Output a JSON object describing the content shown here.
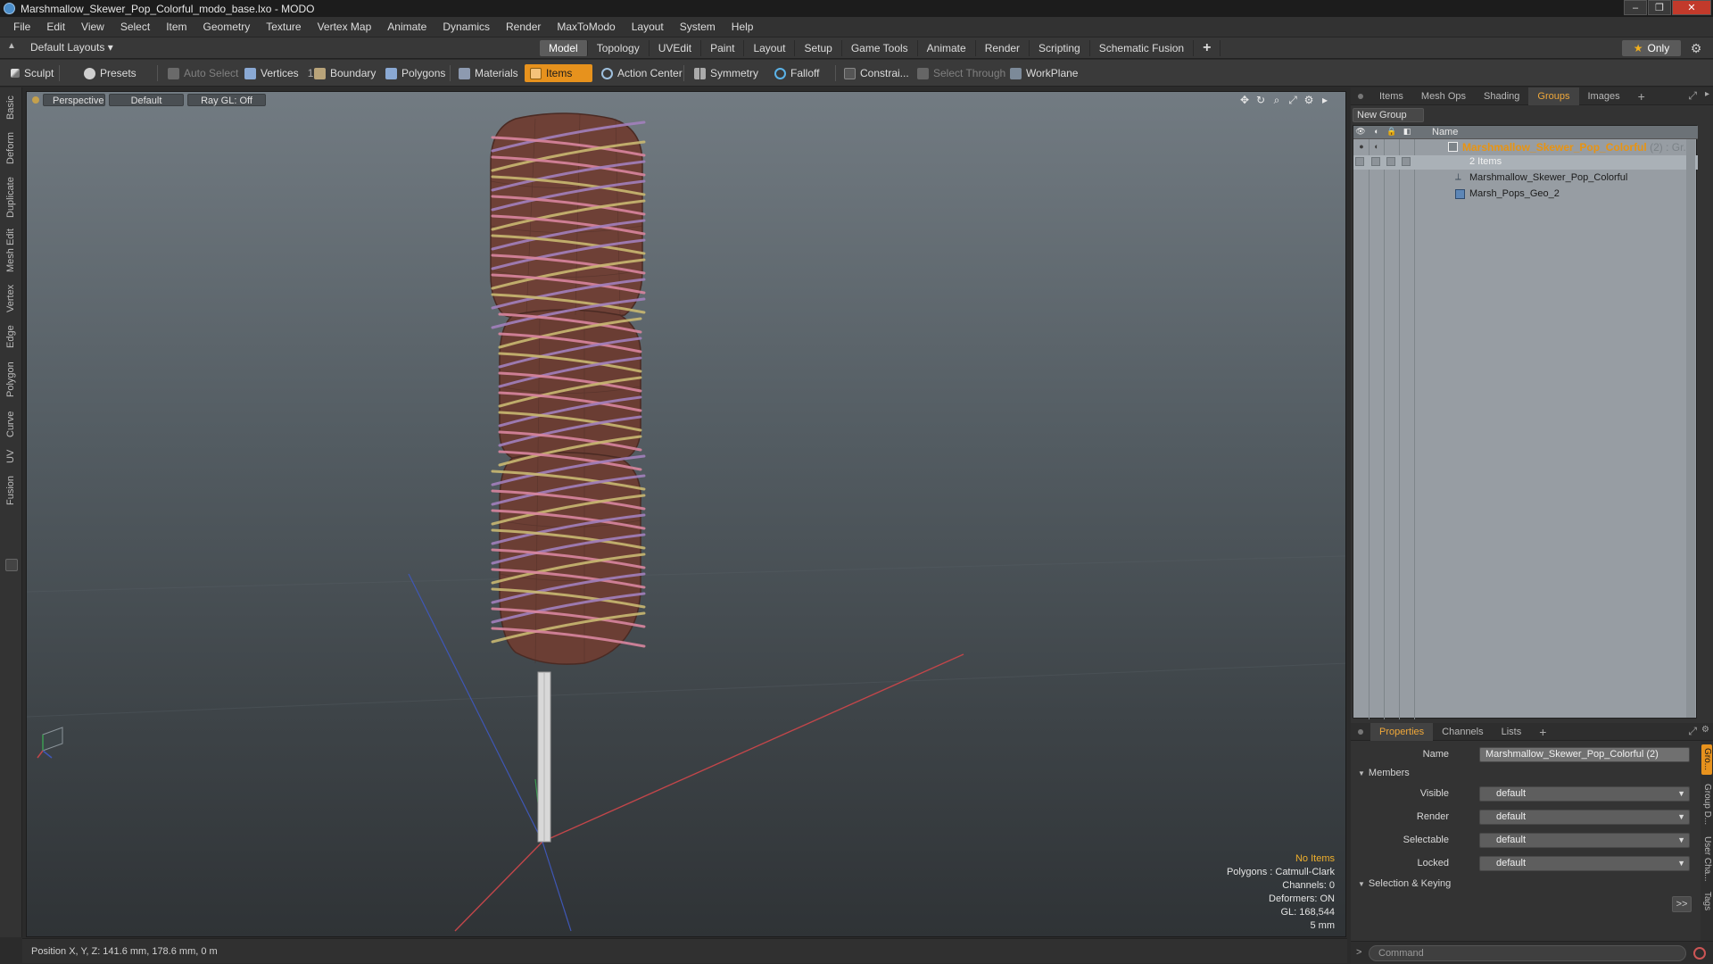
{
  "window": {
    "title": "Marshmallow_Skewer_Pop_Colorful_modo_base.lxo - MODO",
    "controls": [
      "–",
      "❐",
      "✕"
    ]
  },
  "menu": [
    "File",
    "Edit",
    "View",
    "Select",
    "Item",
    "Geometry",
    "Texture",
    "Vertex Map",
    "Animate",
    "Dynamics",
    "Render",
    "MaxToModo",
    "Layout",
    "System",
    "Help"
  ],
  "layout_bar": {
    "layout_select": "Default Layouts ▾",
    "tabs": [
      "Model",
      "Topology",
      "UVEdit",
      "Paint",
      "Layout",
      "Setup",
      "Game Tools",
      "Animate",
      "Render",
      "Scripting",
      "Schematic Fusion"
    ],
    "active_tab": "Model",
    "plus": "+",
    "only_label": "Only"
  },
  "toolbar": {
    "sculpt": "Sculpt",
    "presets": "Presets",
    "auto_select": "Auto Select",
    "vertices": "Vertices",
    "vertices_count": "1",
    "boundary": "Boundary",
    "polygons": "Polygons",
    "materials": "Materials",
    "items": "Items",
    "action_center": "Action Center",
    "symmetry": "Symmetry",
    "falloff": "Falloff",
    "constraints": "Constrai...",
    "select_through": "Select Through",
    "workplane": "WorkPlane"
  },
  "left_tabs": [
    "Basic",
    "Deform",
    "Duplicate",
    "Mesh Edit",
    "Vertex",
    "Edge",
    "Polygon",
    "Curve",
    "UV",
    "Fusion"
  ],
  "viewport": {
    "view": "Perspective",
    "shading": "Default",
    "raygl": "Ray GL: Off",
    "info": {
      "selection": "No Items",
      "polygons": "Polygons : Catmull-Clark",
      "channels": "Channels: 0",
      "deformers": "Deformers: ON",
      "gl": "GL: 168,544",
      "grid": "5 mm"
    }
  },
  "status": {
    "position": "Position X, Y, Z:  141.6 mm, 178.6 mm, 0 m"
  },
  "groups_panel": {
    "tabs": [
      "Items",
      "Mesh Ops",
      "Shading",
      "Groups",
      "Images"
    ],
    "active_tab": "Groups",
    "plus": "+",
    "new_group": "New Group",
    "column_name": "Name",
    "group_name": "Marshmallow_Skewer_Pop_Colorful",
    "group_count": "(2) : Gr...",
    "group_items_count": "2 Items",
    "children": [
      "Marshmallow_Skewer_Pop_Colorful",
      "Marsh_Pops_Geo_2"
    ]
  },
  "properties_panel": {
    "tabs": [
      "Properties",
      "Channels",
      "Lists"
    ],
    "active_tab": "Properties",
    "plus": "+",
    "name_label": "Name",
    "name_value": "Marshmallow_Skewer_Pop_Colorful (2)",
    "members_section": "Members",
    "visible_label": "Visible",
    "visible_value": "default",
    "render_label": "Render",
    "render_value": "default",
    "selectable_label": "Selectable",
    "selectable_value": "default",
    "locked_label": "Locked",
    "locked_value": "default",
    "selection_keying_section": "Selection & Keying",
    "more_button": ">>",
    "side_tabs": [
      "Gro...",
      "Group D...",
      "User Cha...",
      "Tags"
    ]
  },
  "command": {
    "placeholder": "Command",
    "prompt": ">"
  },
  "colors": {
    "accent": "#e7921d",
    "group_label": "#e89412",
    "marshmallow": "#6e4036",
    "stripe_pink": "#d8859e",
    "stripe_yellow": "#c9b871",
    "stripe_purple": "#a27fbd"
  }
}
